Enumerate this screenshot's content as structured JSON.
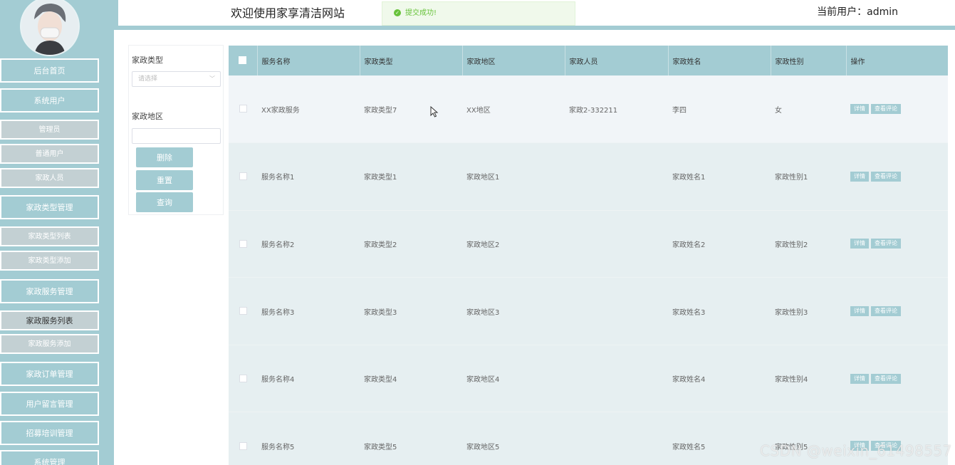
{
  "header": {
    "site_title": "欢迎使用家享清洁网站",
    "toast": "提交成功!",
    "user_label": "当前用户：admin"
  },
  "sidebar": {
    "items": [
      {
        "label": "后台首页",
        "type": "main"
      },
      {
        "label": "系统用户",
        "type": "main"
      },
      {
        "label": "管理员",
        "type": "sub"
      },
      {
        "label": "普通用户",
        "type": "sub"
      },
      {
        "label": "家政人员",
        "type": "sub"
      },
      {
        "label": "家政类型管理",
        "type": "main"
      },
      {
        "label": "家政类型列表",
        "type": "sub"
      },
      {
        "label": "家政类型添加",
        "type": "sub"
      },
      {
        "label": "家政服务管理",
        "type": "main"
      },
      {
        "label": "家政服务列表",
        "type": "sub-active"
      },
      {
        "label": "家政服务添加",
        "type": "sub"
      },
      {
        "label": "家政订单管理",
        "type": "main"
      },
      {
        "label": "用户留言管理",
        "type": "main"
      },
      {
        "label": "招募培训管理",
        "type": "main"
      },
      {
        "label": "系统管理",
        "type": "main"
      }
    ]
  },
  "search": {
    "type_label": "家政类型",
    "type_placeholder": "请选择",
    "area_label": "家政地区",
    "area_value": "",
    "delete_label": "删除",
    "reset_label": "重置",
    "query_label": "查询"
  },
  "table": {
    "columns": [
      "服务名称",
      "家政类型",
      "家政地区",
      "家政人员",
      "家政姓名",
      "家政性别",
      "操作"
    ],
    "rows": [
      [
        "XX家政服务",
        "家政类型7",
        "XX地区",
        "家政2-332211",
        "李四",
        "女"
      ],
      [
        "服务名称1",
        "家政类型1",
        "家政地区1",
        "",
        "家政姓名1",
        "家政性别1"
      ],
      [
        "服务名称2",
        "家政类型2",
        "家政地区2",
        "",
        "家政姓名2",
        "家政性别2"
      ],
      [
        "服务名称3",
        "家政类型3",
        "家政地区3",
        "",
        "家政姓名3",
        "家政性别3"
      ],
      [
        "服务名称4",
        "家政类型4",
        "家政地区4",
        "",
        "家政姓名4",
        "家政性别4"
      ],
      [
        "服务名称5",
        "家政类型5",
        "家政地区5",
        "",
        "家政姓名5",
        "家政性别5"
      ]
    ],
    "detail_label": "详情",
    "review_label": "查看评论"
  },
  "watermark": "CSDN @weixin_61498557",
  "colors": {
    "accent": "#a3ccd3",
    "sub_menu": "#c3d0d3",
    "success": "#67c23a"
  }
}
